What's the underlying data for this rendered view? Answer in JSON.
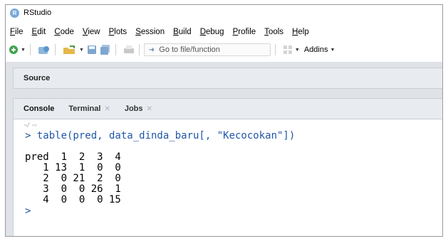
{
  "window": {
    "title": "RStudio"
  },
  "menubar": {
    "items": [
      {
        "label": "File",
        "underline": "F",
        "rest": "ile"
      },
      {
        "label": "Edit",
        "underline": "E",
        "rest": "dit"
      },
      {
        "label": "Code",
        "underline": "C",
        "rest": "ode"
      },
      {
        "label": "View",
        "underline": "V",
        "rest": "iew"
      },
      {
        "label": "Plots",
        "underline": "P",
        "rest": "lots"
      },
      {
        "label": "Session",
        "underline": "S",
        "rest": "ession"
      },
      {
        "label": "Build",
        "underline": "B",
        "rest": "uild"
      },
      {
        "label": "Debug",
        "underline": "D",
        "rest": "ebug"
      },
      {
        "label": "Profile",
        "underline": "P",
        "rest": "rofile"
      },
      {
        "label": "Tools",
        "underline": "T",
        "rest": "ools"
      },
      {
        "label": "Help",
        "underline": "H",
        "rest": "elp"
      }
    ]
  },
  "toolbar": {
    "goto_placeholder": "Go to file/function",
    "addins_label": "Addins"
  },
  "source_pane": {
    "title": "Source"
  },
  "console_pane": {
    "tabs": [
      {
        "label": "Console",
        "closable": false
      },
      {
        "label": "Terminal",
        "closable": true
      },
      {
        "label": "Jobs",
        "closable": true
      }
    ],
    "working_dir": "~/",
    "command": "> table(pred, data_dinda_baru[, \"Kecocokan\"])",
    "output_lines": [
      "pred  1  2  3  4",
      "   1 13  1  0  0",
      "   2  0 21  2  0",
      "   3  0  0 26  1",
      "   4  0  0  0 15"
    ],
    "prompt": ">"
  },
  "colors": {
    "console_text": "#1f56a8",
    "pane_header": "#e8ecf0",
    "rstudio_logo": "#75aadb"
  }
}
